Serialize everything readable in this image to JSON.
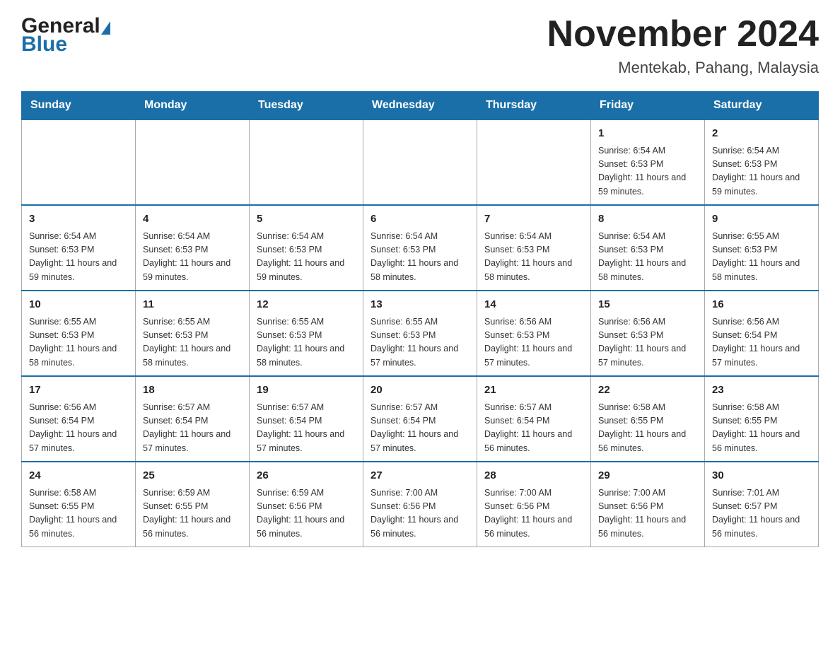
{
  "header": {
    "logo_general": "General",
    "logo_blue": "Blue",
    "month_title": "November 2024",
    "location": "Mentekab, Pahang, Malaysia"
  },
  "weekdays": [
    "Sunday",
    "Monday",
    "Tuesday",
    "Wednesday",
    "Thursday",
    "Friday",
    "Saturday"
  ],
  "weeks": [
    [
      {
        "day": "",
        "info": ""
      },
      {
        "day": "",
        "info": ""
      },
      {
        "day": "",
        "info": ""
      },
      {
        "day": "",
        "info": ""
      },
      {
        "day": "",
        "info": ""
      },
      {
        "day": "1",
        "info": "Sunrise: 6:54 AM\nSunset: 6:53 PM\nDaylight: 11 hours and 59 minutes."
      },
      {
        "day": "2",
        "info": "Sunrise: 6:54 AM\nSunset: 6:53 PM\nDaylight: 11 hours and 59 minutes."
      }
    ],
    [
      {
        "day": "3",
        "info": "Sunrise: 6:54 AM\nSunset: 6:53 PM\nDaylight: 11 hours and 59 minutes."
      },
      {
        "day": "4",
        "info": "Sunrise: 6:54 AM\nSunset: 6:53 PM\nDaylight: 11 hours and 59 minutes."
      },
      {
        "day": "5",
        "info": "Sunrise: 6:54 AM\nSunset: 6:53 PM\nDaylight: 11 hours and 59 minutes."
      },
      {
        "day": "6",
        "info": "Sunrise: 6:54 AM\nSunset: 6:53 PM\nDaylight: 11 hours and 58 minutes."
      },
      {
        "day": "7",
        "info": "Sunrise: 6:54 AM\nSunset: 6:53 PM\nDaylight: 11 hours and 58 minutes."
      },
      {
        "day": "8",
        "info": "Sunrise: 6:54 AM\nSunset: 6:53 PM\nDaylight: 11 hours and 58 minutes."
      },
      {
        "day": "9",
        "info": "Sunrise: 6:55 AM\nSunset: 6:53 PM\nDaylight: 11 hours and 58 minutes."
      }
    ],
    [
      {
        "day": "10",
        "info": "Sunrise: 6:55 AM\nSunset: 6:53 PM\nDaylight: 11 hours and 58 minutes."
      },
      {
        "day": "11",
        "info": "Sunrise: 6:55 AM\nSunset: 6:53 PM\nDaylight: 11 hours and 58 minutes."
      },
      {
        "day": "12",
        "info": "Sunrise: 6:55 AM\nSunset: 6:53 PM\nDaylight: 11 hours and 58 minutes."
      },
      {
        "day": "13",
        "info": "Sunrise: 6:55 AM\nSunset: 6:53 PM\nDaylight: 11 hours and 57 minutes."
      },
      {
        "day": "14",
        "info": "Sunrise: 6:56 AM\nSunset: 6:53 PM\nDaylight: 11 hours and 57 minutes."
      },
      {
        "day": "15",
        "info": "Sunrise: 6:56 AM\nSunset: 6:53 PM\nDaylight: 11 hours and 57 minutes."
      },
      {
        "day": "16",
        "info": "Sunrise: 6:56 AM\nSunset: 6:54 PM\nDaylight: 11 hours and 57 minutes."
      }
    ],
    [
      {
        "day": "17",
        "info": "Sunrise: 6:56 AM\nSunset: 6:54 PM\nDaylight: 11 hours and 57 minutes."
      },
      {
        "day": "18",
        "info": "Sunrise: 6:57 AM\nSunset: 6:54 PM\nDaylight: 11 hours and 57 minutes."
      },
      {
        "day": "19",
        "info": "Sunrise: 6:57 AM\nSunset: 6:54 PM\nDaylight: 11 hours and 57 minutes."
      },
      {
        "day": "20",
        "info": "Sunrise: 6:57 AM\nSunset: 6:54 PM\nDaylight: 11 hours and 57 minutes."
      },
      {
        "day": "21",
        "info": "Sunrise: 6:57 AM\nSunset: 6:54 PM\nDaylight: 11 hours and 56 minutes."
      },
      {
        "day": "22",
        "info": "Sunrise: 6:58 AM\nSunset: 6:55 PM\nDaylight: 11 hours and 56 minutes."
      },
      {
        "day": "23",
        "info": "Sunrise: 6:58 AM\nSunset: 6:55 PM\nDaylight: 11 hours and 56 minutes."
      }
    ],
    [
      {
        "day": "24",
        "info": "Sunrise: 6:58 AM\nSunset: 6:55 PM\nDaylight: 11 hours and 56 minutes."
      },
      {
        "day": "25",
        "info": "Sunrise: 6:59 AM\nSunset: 6:55 PM\nDaylight: 11 hours and 56 minutes."
      },
      {
        "day": "26",
        "info": "Sunrise: 6:59 AM\nSunset: 6:56 PM\nDaylight: 11 hours and 56 minutes."
      },
      {
        "day": "27",
        "info": "Sunrise: 7:00 AM\nSunset: 6:56 PM\nDaylight: 11 hours and 56 minutes."
      },
      {
        "day": "28",
        "info": "Sunrise: 7:00 AM\nSunset: 6:56 PM\nDaylight: 11 hours and 56 minutes."
      },
      {
        "day": "29",
        "info": "Sunrise: 7:00 AM\nSunset: 6:56 PM\nDaylight: 11 hours and 56 minutes."
      },
      {
        "day": "30",
        "info": "Sunrise: 7:01 AM\nSunset: 6:57 PM\nDaylight: 11 hours and 56 minutes."
      }
    ]
  ]
}
